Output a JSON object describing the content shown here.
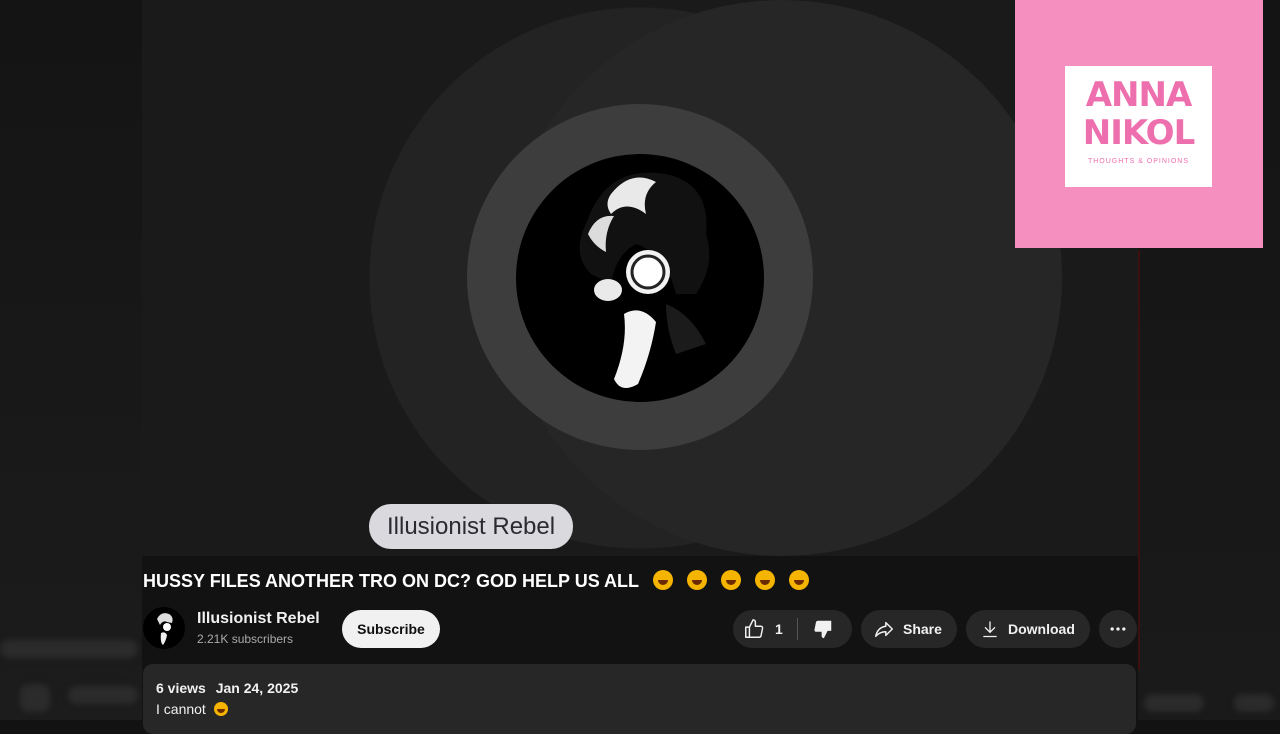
{
  "video": {
    "overlay_name": "Illusionist Rebel",
    "title": "HUSSY FILES ANOTHER TRO ON DC? GOD HELP US ALL"
  },
  "logo": {
    "line1": "ANNA",
    "line2": "NIKOL",
    "tagline": "THOUGHTS & OPINIONS"
  },
  "channel": {
    "name": "Illusionist Rebel",
    "subscribers": "2.21K subscribers",
    "subscribe_label": "Subscribe"
  },
  "actions": {
    "like_count": "1",
    "share_label": "Share",
    "download_label": "Download"
  },
  "description": {
    "views": "6 views",
    "date": "Jan 24, 2025",
    "text": "I cannot"
  },
  "colors": {
    "background": "#121212",
    "logo_pink": "#f48fc0",
    "pill_bg": "#272727"
  },
  "icons": [
    "like-icon",
    "dislike-icon",
    "share-icon",
    "download-icon",
    "more-icon",
    "rofl-emoji"
  ]
}
